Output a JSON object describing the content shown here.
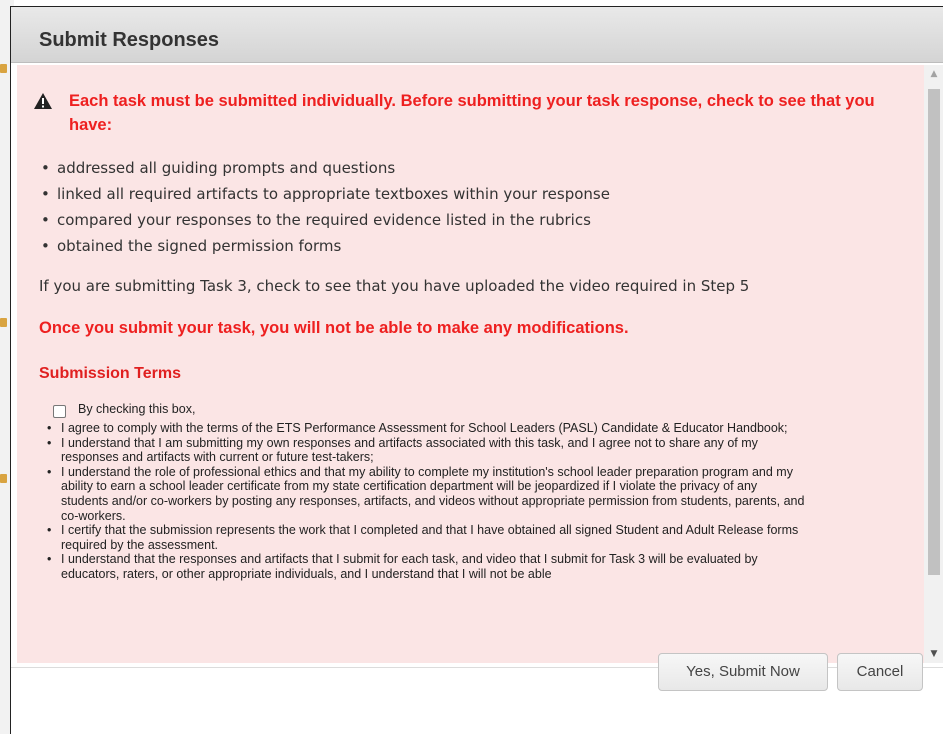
{
  "dialog": {
    "title": "Submit Responses",
    "warning": "Each task must be submitted individually. Before submitting your task response, check to see that you have:",
    "checklist": [
      "addressed all guiding prompts and questions",
      "linked all required artifacts to appropriate textboxes within your response",
      "compared your responses to the required evidence listed in the rubrics",
      "obtained the signed permission forms"
    ],
    "task3_note": "If you are submitting Task 3, check to see that you have uploaded the video required in Step 5",
    "once_notice": "Once you submit your task, you will not be able to make any modifications.",
    "terms_title": "Submission Terms",
    "checkbox_label": "By checking this box,",
    "checkbox_checked": false,
    "terms": [
      "I agree to comply with the terms of the ETS Performance Assessment for School Leaders (PASL) Candidate & Educator Handbook;",
      "I understand that I am submitting my own responses and artifacts associated with this task, and I agree not to share any of my responses and artifacts with current or future test-takers;",
      "I understand the role of professional ethics and that my ability to complete my institution's school leader preparation program and my ability to earn a school leader certificate from my state certification department will be jeopardized if I violate the privacy of any students and/or co-workers by posting any responses, artifacts, and videos without appropriate permission from students, parents, and co-workers.",
      "I certify that the submission represents the work that I completed and that I have obtained all signed Student and Adult Release forms required by the assessment.",
      "I understand that the responses and artifacts that I submit for each task, and video that I submit for Task 3 will be evaluated by educators, raters, or other appropriate individuals, and I understand that I will not be able"
    ],
    "buttons": {
      "submit": "Yes, Submit Now",
      "cancel": "Cancel"
    }
  },
  "icons": {
    "warning": "warning-triangle-icon",
    "scroll_up": "scroll-up-arrow-icon",
    "scroll_down": "scroll-down-arrow-icon"
  },
  "colors": {
    "content_bg": "#fbe5e5",
    "warning_text": "#ee2020",
    "titlebar": "#dcdcdc"
  }
}
